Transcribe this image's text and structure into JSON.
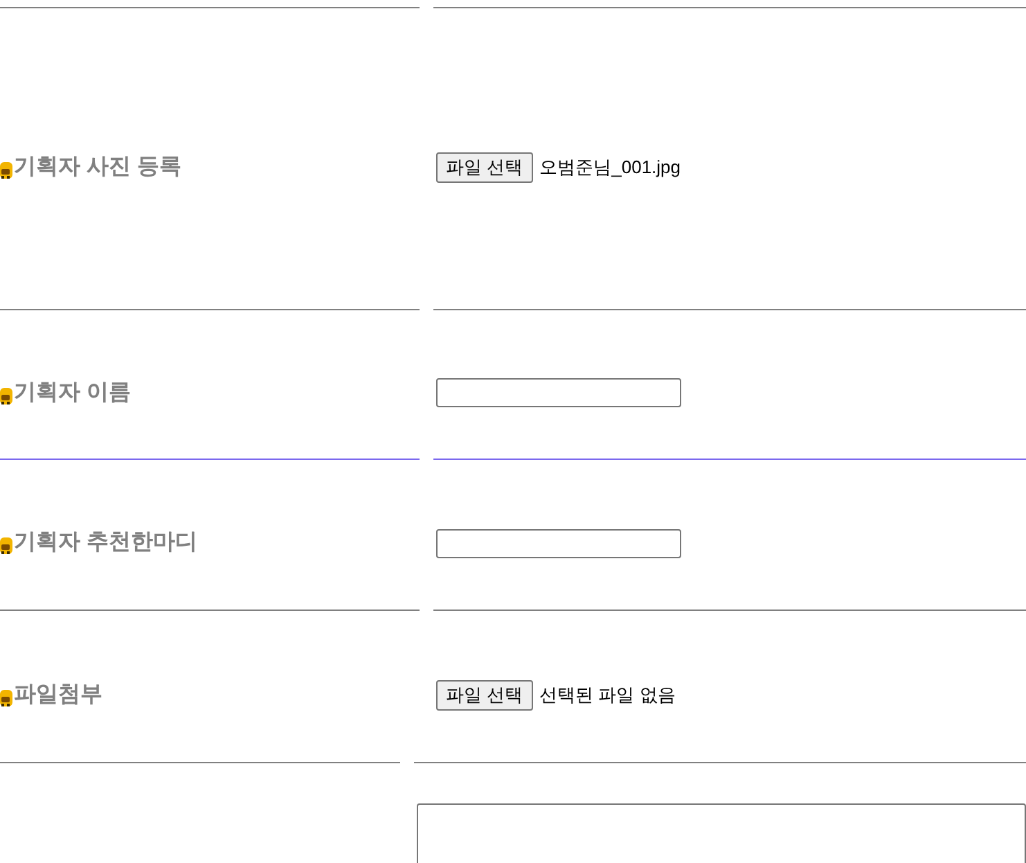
{
  "rows": [
    {
      "label": "기획자 사진 등록",
      "kind": "file",
      "highlighted": false,
      "button": "파일 선택",
      "file_name": "오범준님_001.jpg"
    },
    {
      "label": "기획자 이름",
      "kind": "text",
      "highlighted": false
    },
    {
      "label": "기획자 추천한마디",
      "kind": "text",
      "highlighted": true
    },
    {
      "label": "파일첨부",
      "kind": "file",
      "highlighted": false,
      "button": "파일 선택",
      "file_name": "선택된 파일 없음"
    },
    {
      "kind": "textarea",
      "highlighted": false
    }
  ]
}
